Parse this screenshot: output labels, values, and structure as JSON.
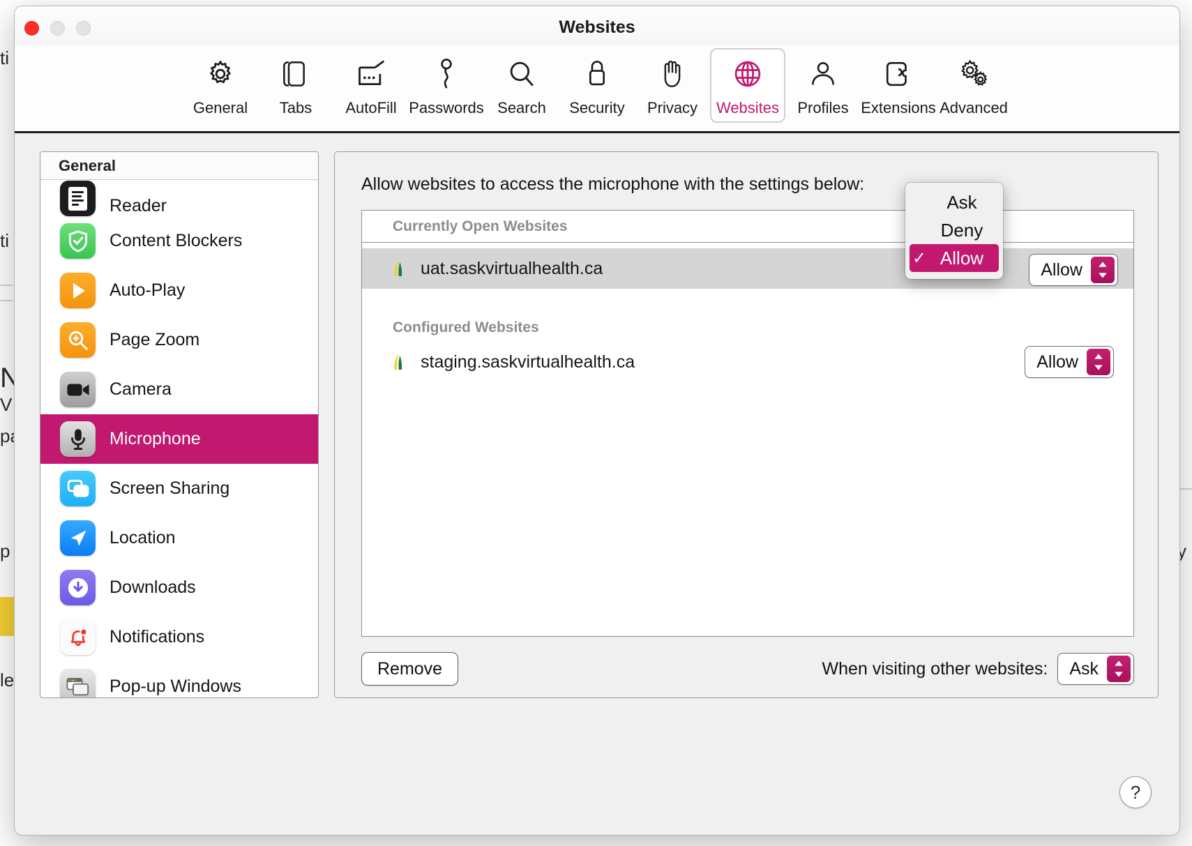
{
  "window": {
    "title": "Websites",
    "traffic_lights": [
      "close",
      "minimize",
      "maximize"
    ]
  },
  "toolbar": {
    "items": [
      {
        "label": "General",
        "icon": "gear-icon",
        "selected": false
      },
      {
        "label": "Tabs",
        "icon": "tabs-icon",
        "selected": false
      },
      {
        "label": "AutoFill",
        "icon": "autofill-icon",
        "selected": false
      },
      {
        "label": "Passwords",
        "icon": "key-icon",
        "selected": false
      },
      {
        "label": "Search",
        "icon": "search-icon",
        "selected": false
      },
      {
        "label": "Security",
        "icon": "lock-icon",
        "selected": false
      },
      {
        "label": "Privacy",
        "icon": "hand-icon",
        "selected": false
      },
      {
        "label": "Websites",
        "icon": "globe-icon",
        "selected": true
      },
      {
        "label": "Profiles",
        "icon": "person-icon",
        "selected": false
      },
      {
        "label": "Extensions",
        "icon": "puzzle-icon",
        "selected": false
      },
      {
        "label": "Advanced",
        "icon": "gears-icon",
        "selected": false
      }
    ]
  },
  "sidebar": {
    "header": "General",
    "items": [
      {
        "label": "Reader",
        "icon": "reader-icon",
        "selected": false
      },
      {
        "label": "Content Blockers",
        "icon": "shield-check-icon",
        "selected": false
      },
      {
        "label": "Auto-Play",
        "icon": "play-icon",
        "selected": false
      },
      {
        "label": "Page Zoom",
        "icon": "magnifier-plus-icon",
        "selected": false
      },
      {
        "label": "Camera",
        "icon": "camera-icon",
        "selected": false
      },
      {
        "label": "Microphone",
        "icon": "microphone-icon",
        "selected": true
      },
      {
        "label": "Screen Sharing",
        "icon": "screen-share-icon",
        "selected": false
      },
      {
        "label": "Location",
        "icon": "location-arrow-icon",
        "selected": false
      },
      {
        "label": "Downloads",
        "icon": "download-icon",
        "selected": false
      },
      {
        "label": "Notifications",
        "icon": "bell-badge-icon",
        "selected": false
      },
      {
        "label": "Pop-up Windows",
        "icon": "popup-windows-icon",
        "selected": false
      }
    ]
  },
  "main": {
    "heading": "Allow websites to access the microphone with the settings below:",
    "groups": [
      {
        "title": "Currently Open Websites",
        "rows": [
          {
            "site": "uat.saskvirtualhealth.ca",
            "permission": "Allow",
            "selected": true,
            "favicon": "sask-leaf-favicon"
          }
        ]
      },
      {
        "title": "Configured Websites",
        "rows": [
          {
            "site": "staging.saskvirtualhealth.ca",
            "permission": "Allow",
            "selected": false,
            "favicon": "sask-leaf-favicon"
          }
        ]
      }
    ],
    "remove_label": "Remove",
    "visiting_label": "When visiting other websites:",
    "visiting_value": "Ask",
    "help_label": "?"
  },
  "dropdown": {
    "open": true,
    "options": [
      {
        "label": "Ask",
        "checked": false
      },
      {
        "label": "Deny",
        "checked": false
      },
      {
        "label": "Allow",
        "checked": true
      }
    ],
    "checkmark": "✓"
  },
  "colors": {
    "accent": "#c2186f",
    "selected_row": "#d5d5d5",
    "window_bg": "#f0f0f0"
  },
  "background_page": {
    "fragments": [
      "ti",
      "ti",
      "N",
      "V",
      "pa",
      "p",
      "le",
      "y"
    ]
  }
}
